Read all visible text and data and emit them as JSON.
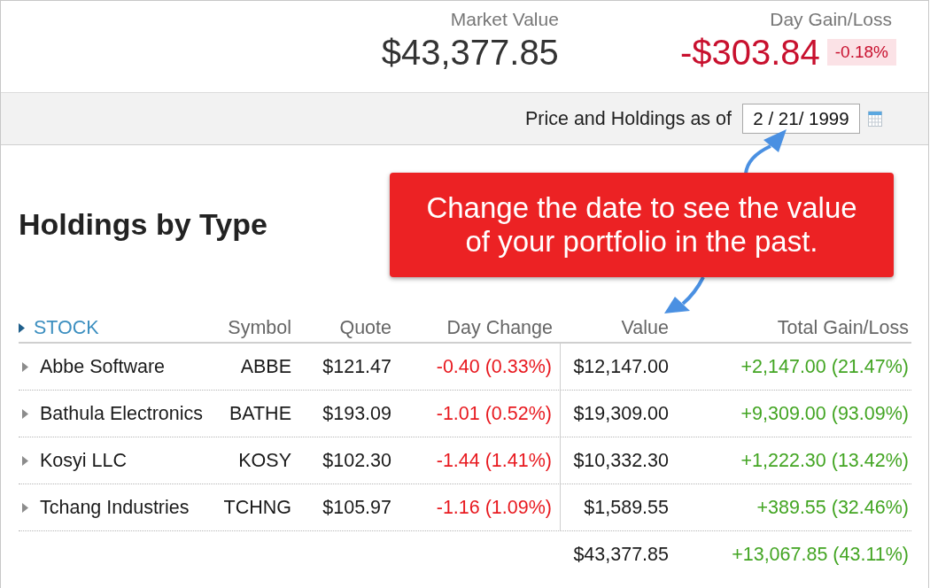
{
  "summary": {
    "market_value": {
      "label": "Market Value",
      "value": "$43,377.85"
    },
    "day_gain_loss": {
      "label": "Day Gain/Loss",
      "value": "-$303.84",
      "percent": "-0.18%",
      "negative": true
    }
  },
  "date_bar": {
    "label": "Price and Holdings as of",
    "date_field": {
      "value": "2 / 21/ 1999"
    }
  },
  "section_title": "Holdings by Type",
  "callout": {
    "text": "Change the date to see the value of your portfolio in the past."
  },
  "table": {
    "group": {
      "label": "STOCK"
    },
    "columns": [
      "Symbol",
      "Quote",
      "Day Change",
      "Value",
      "Total Gain/Loss"
    ],
    "rows": [
      {
        "name": "Abbe Software",
        "expanded": false,
        "symbol": "ABBE",
        "quote": "$121.47",
        "day_change": {
          "text": "-0.40 (0.33%)",
          "negative": true
        },
        "value": "$12,147.00",
        "total_gain_loss": {
          "text": "+2,147.00 (21.47%)",
          "negative": false
        }
      },
      {
        "name": "Bathula Electronics",
        "expanded": false,
        "symbol": "BATHE",
        "quote": "$193.09",
        "day_change": {
          "text": "-1.01 (0.52%)",
          "negative": true
        },
        "value": "$19,309.00",
        "total_gain_loss": {
          "text": "+9,309.00 (93.09%)",
          "negative": false
        }
      },
      {
        "name": "Kosyi LLC",
        "expanded": false,
        "symbol": "KOSY",
        "quote": "$102.30",
        "day_change": {
          "text": "-1.44 (1.41%)",
          "negative": true
        },
        "value": "$10,332.30",
        "total_gain_loss": {
          "text": "+1,222.30 (13.42%)",
          "negative": false
        }
      },
      {
        "name": "Tchang Industries",
        "expanded": false,
        "symbol": "TCHNG",
        "quote": "$105.97",
        "day_change": {
          "text": "-1.16 (1.09%)",
          "negative": true
        },
        "value": "$1,589.55",
        "total_gain_loss": {
          "text": "+389.55 (32.46%)",
          "negative": false
        }
      }
    ],
    "total": {
      "value": "$43,377.85",
      "total_gain_loss": {
        "text": "+13,067.85 (43.11%)",
        "negative": false
      }
    }
  }
}
